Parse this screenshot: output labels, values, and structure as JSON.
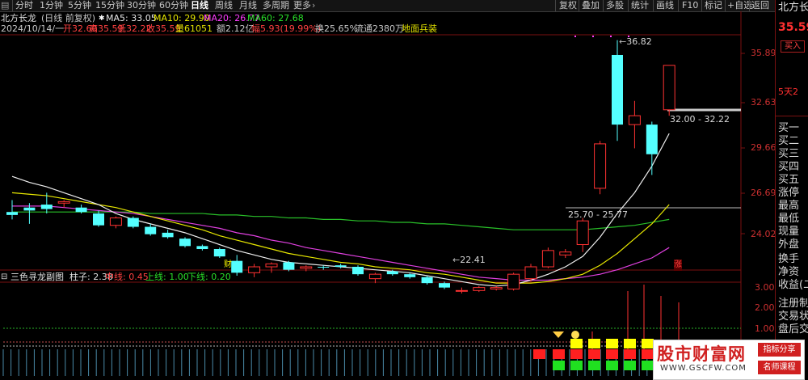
{
  "toolbar": {
    "tabs": [
      "分时",
      "1分钟",
      "5分钟",
      "15分钟",
      "30分钟",
      "60分钟",
      "日线",
      "周线",
      "月线",
      "多周期",
      "更多"
    ],
    "active_tab": "日线",
    "more_arrow": "›",
    "buttons": [
      "复权",
      "叠加",
      "多股",
      "统计",
      "画线",
      "F10",
      "标记",
      "+自选",
      "返回"
    ]
  },
  "info": {
    "stock_name": "北方长龙",
    "period_label": "(日线 前复权)",
    "ma5_label": "MA5: 33.05",
    "ma10_label": "MA10: 29.90",
    "ma20_label": "MA20: 26.77",
    "ma60_label": "MA60: 27.68",
    "date": "2024/10/14/一",
    "open": "开32.60",
    "high": "高35.59",
    "low": "低32.22",
    "close": "收35.59",
    "volume": "量61051",
    "amount": "额2.12亿",
    "change": "幅5.93(19.99%)",
    "turnover": "换25.65%",
    "float": "流通2380万",
    "tag": "地面兵装"
  },
  "price_axis": [
    "35.89",
    "32.63",
    "29.66",
    "26.69",
    "24.02"
  ],
  "annotations": {
    "high_mark": "36.82",
    "range_upper": "32.00 - 32.22",
    "range_lower": "25.70 - 25.77",
    "low_mark": "22.41",
    "cai_label": "财",
    "zhang_label": "涨"
  },
  "indicator": {
    "name": "三色寻龙副图",
    "zhuzi": "柱子: 2.38",
    "zhongxian": "中线: 0.45",
    "shangxian": "上线: 1.00",
    "xiaxian": "下线: 0.20",
    "axis": [
      "3.00",
      "2.00",
      "1.00"
    ]
  },
  "right_panel": {
    "title": "北方长",
    "price": "35.59",
    "buy_button": "买入",
    "five_day": "5天2",
    "rows": [
      "买一",
      "买二",
      "买三",
      "买四",
      "买五",
      "涨停",
      "最高",
      "最低",
      "现量",
      "外盘",
      "换手",
      "净资",
      "收益(二",
      "注册制",
      "交易状",
      "盘后交"
    ]
  },
  "watermark": {
    "title": "股市财富网",
    "url": "WWW.GSCFW.COM",
    "tag1": "指标分享",
    "tag2": "名师课程"
  },
  "chart_data": {
    "type": "candlestick",
    "ylim": [
      22.0,
      37.5
    ],
    "candles": [
      {
        "o": 25.7,
        "h": 26.5,
        "l": 25.2,
        "c": 25.5
      },
      {
        "o": 26.0,
        "h": 26.3,
        "l": 24.9,
        "c": 25.8
      },
      {
        "o": 26.2,
        "h": 27.0,
        "l": 25.6,
        "c": 25.9
      },
      {
        "o": 26.3,
        "h": 26.5,
        "l": 26.0,
        "c": 26.4
      },
      {
        "o": 26.0,
        "h": 26.2,
        "l": 25.6,
        "c": 25.7
      },
      {
        "o": 25.6,
        "h": 25.8,
        "l": 24.7,
        "c": 24.8
      },
      {
        "o": 24.8,
        "h": 25.4,
        "l": 24.6,
        "c": 25.3
      },
      {
        "o": 25.3,
        "h": 25.4,
        "l": 24.6,
        "c": 24.7
      },
      {
        "o": 24.7,
        "h": 24.9,
        "l": 24.1,
        "c": 24.2
      },
      {
        "o": 24.3,
        "h": 24.5,
        "l": 23.9,
        "c": 24.0
      },
      {
        "o": 23.9,
        "h": 24.0,
        "l": 23.3,
        "c": 23.4
      },
      {
        "o": 23.4,
        "h": 23.5,
        "l": 23.1,
        "c": 23.2
      },
      {
        "o": 23.2,
        "h": 23.3,
        "l": 22.6,
        "c": 22.7
      },
      {
        "o": 22.4,
        "h": 22.8,
        "l": 21.4,
        "c": 21.6
      },
      {
        "o": 21.6,
        "h": 22.2,
        "l": 21.3,
        "c": 22.0
      },
      {
        "o": 22.0,
        "h": 22.3,
        "l": 21.6,
        "c": 22.2
      },
      {
        "o": 22.3,
        "h": 22.4,
        "l": 21.7,
        "c": 21.8
      },
      {
        "o": 21.9,
        "h": 22.1,
        "l": 21.7,
        "c": 22.0
      },
      {
        "o": 22.0,
        "h": 22.1,
        "l": 21.8,
        "c": 21.95
      },
      {
        "o": 22.1,
        "h": 22.2,
        "l": 21.9,
        "c": 22.0
      },
      {
        "o": 22.0,
        "h": 22.1,
        "l": 21.4,
        "c": 21.5
      },
      {
        "o": 21.2,
        "h": 21.6,
        "l": 20.9,
        "c": 21.5
      },
      {
        "o": 21.7,
        "h": 21.8,
        "l": 21.4,
        "c": 21.5
      },
      {
        "o": 21.5,
        "h": 21.6,
        "l": 21.2,
        "c": 21.3
      },
      {
        "o": 21.3,
        "h": 21.4,
        "l": 20.8,
        "c": 20.9
      },
      {
        "o": 20.9,
        "h": 21.0,
        "l": 20.5,
        "c": 20.6
      },
      {
        "o": 20.4,
        "h": 20.6,
        "l": 20.2,
        "c": 20.4
      },
      {
        "o": 20.4,
        "h": 20.7,
        "l": 20.3,
        "c": 20.6
      },
      {
        "o": 20.5,
        "h": 20.7,
        "l": 20.4,
        "c": 20.6
      },
      {
        "o": 20.5,
        "h": 21.6,
        "l": 20.4,
        "c": 21.5
      },
      {
        "o": 21.2,
        "h": 22.2,
        "l": 21.0,
        "c": 22.0
      },
      {
        "o": 22.0,
        "h": 23.3,
        "l": 21.9,
        "c": 23.1
      },
      {
        "o": 22.8,
        "h": 23.2,
        "l": 22.6,
        "c": 23.0
      },
      {
        "o": 23.5,
        "h": 25.3,
        "l": 23.0,
        "c": 25.1
      },
      {
        "o": 27.3,
        "h": 30.5,
        "l": 26.9,
        "c": 30.3
      },
      {
        "o": 36.3,
        "h": 37.3,
        "l": 30.5,
        "c": 31.6
      },
      {
        "o": 31.6,
        "h": 33.2,
        "l": 30.0,
        "c": 32.2
      },
      {
        "o": 31.6,
        "h": 31.8,
        "l": 28.2,
        "c": 29.6
      },
      {
        "o": 32.6,
        "h": 35.6,
        "l": 32.2,
        "c": 35.6
      }
    ],
    "ma5": [
      28.1,
      27.7,
      27.4,
      27.0,
      26.6,
      26.2,
      25.6,
      25.2,
      24.9,
      24.6,
      24.3,
      23.9,
      23.5,
      23.1,
      22.8,
      22.5,
      22.3,
      22.2,
      22.1,
      22.0,
      21.9,
      21.8,
      21.7,
      21.6,
      21.4,
      21.2,
      21.0,
      20.8,
      20.7,
      20.8,
      21.1,
      21.5,
      22.0,
      22.7,
      24.0,
      25.6,
      27.0,
      28.8,
      31.0
    ],
    "ma10": [
      27.0,
      26.9,
      26.8,
      26.6,
      26.4,
      26.2,
      26.0,
      25.7,
      25.4,
      25.1,
      24.8,
      24.5,
      24.1,
      23.8,
      23.5,
      23.2,
      22.9,
      22.7,
      22.5,
      22.3,
      22.2,
      22.0,
      21.9,
      21.8,
      21.6,
      21.5,
      21.3,
      21.1,
      20.9,
      20.9,
      20.9,
      21.0,
      21.2,
      21.5,
      22.1,
      22.9,
      23.9,
      24.9,
      26.2
    ],
    "ma20": [
      26.1,
      26.1,
      26.1,
      26.0,
      25.9,
      25.8,
      25.7,
      25.6,
      25.4,
      25.2,
      25.0,
      24.8,
      24.6,
      24.3,
      24.1,
      23.8,
      23.6,
      23.3,
      23.1,
      22.9,
      22.7,
      22.5,
      22.3,
      22.1,
      21.9,
      21.7,
      21.5,
      21.3,
      21.2,
      21.1,
      21.1,
      21.1,
      21.2,
      21.3,
      21.5,
      21.8,
      22.2,
      22.6,
      23.3
    ],
    "ma60": [
      25.7,
      25.7,
      25.7,
      25.7,
      25.7,
      25.7,
      25.7,
      25.7,
      25.6,
      25.6,
      25.6,
      25.6,
      25.5,
      25.5,
      25.4,
      25.4,
      25.3,
      25.3,
      25.2,
      25.2,
      25.1,
      25.1,
      25.0,
      25.0,
      24.9,
      24.9,
      24.8,
      24.7,
      24.6,
      24.5,
      24.5,
      24.5,
      24.5,
      24.5,
      24.6,
      24.7,
      24.8,
      25.0,
      25.2
    ]
  }
}
